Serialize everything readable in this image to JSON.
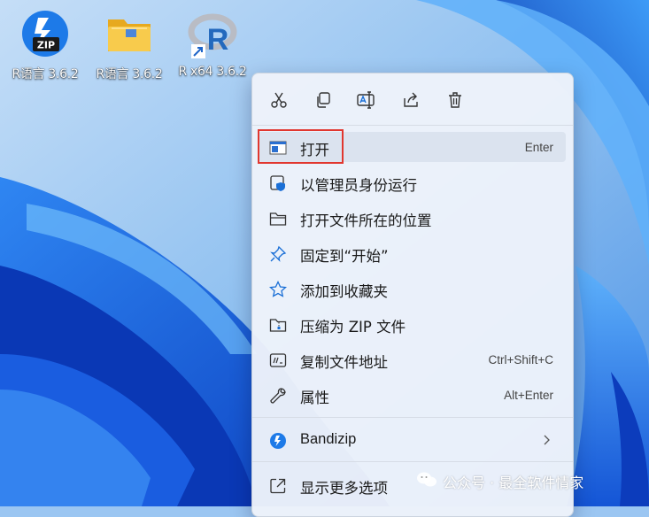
{
  "desktop": {
    "icons": [
      {
        "label": "R语言 3.6.2",
        "icon": "zip-icon"
      },
      {
        "label": "R语言 3.6.2",
        "icon": "folder-icon"
      },
      {
        "label": "R x64 3.6.2",
        "icon": "r-shortcut-icon"
      }
    ]
  },
  "context_menu": {
    "quick_actions": [
      "cut-icon",
      "copy-icon",
      "rename-icon",
      "share-icon",
      "delete-icon"
    ],
    "items": [
      {
        "label": "打开",
        "shortcut": "Enter",
        "icon": "open-window-icon",
        "highlighted": true
      },
      {
        "label": "以管理员身份运行",
        "shortcut": "",
        "icon": "shield-icon"
      },
      {
        "label": "打开文件所在的位置",
        "shortcut": "",
        "icon": "folder-outline-icon"
      },
      {
        "label": "固定到“开始”",
        "shortcut": "",
        "icon": "pin-icon"
      },
      {
        "label": "添加到收藏夹",
        "shortcut": "",
        "icon": "star-icon"
      },
      {
        "label": "压缩为 ZIP 文件",
        "shortcut": "",
        "icon": "zip-file-icon"
      },
      {
        "label": "复制文件地址",
        "shortcut": "Ctrl+Shift+C",
        "icon": "copy-path-icon"
      },
      {
        "label": "属性",
        "shortcut": "Alt+Enter",
        "icon": "wrench-icon"
      }
    ],
    "bandizip": {
      "label": "Bandizip",
      "icon": "bandizip-icon"
    },
    "more": {
      "label": "显示更多选项",
      "icon": "expand-icon"
    }
  },
  "watermark": {
    "text": "公众号 · 最全软件情家"
  },
  "colors": {
    "highlight_border": "#e1372f",
    "menu_bg": "#eef3fa",
    "accent": "#1a6fd6"
  }
}
